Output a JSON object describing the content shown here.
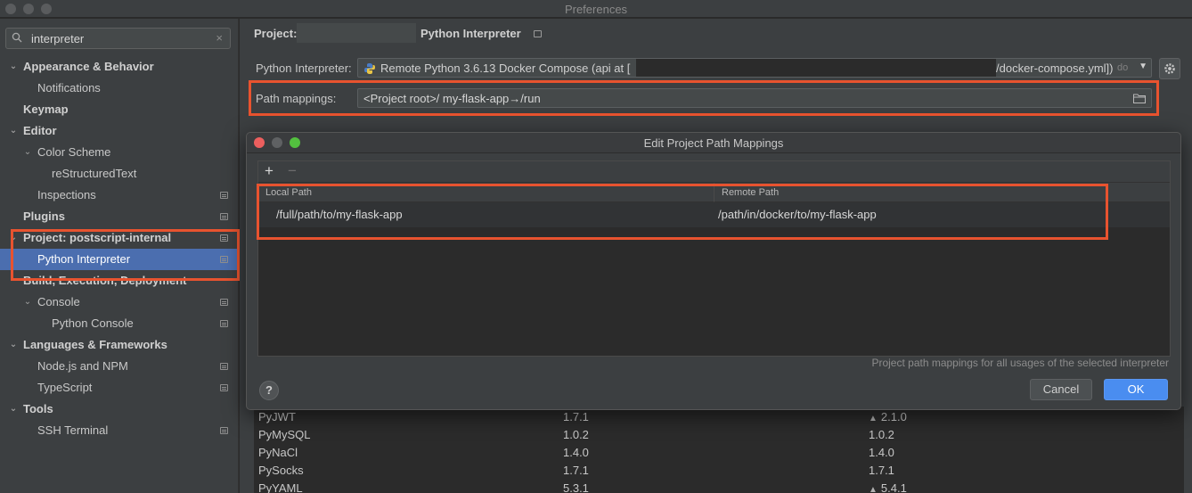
{
  "window": {
    "title": "Preferences"
  },
  "sidebar": {
    "search": {
      "value": "interpreter",
      "clear": "×"
    },
    "items": [
      {
        "label": "Appearance & Behavior",
        "bold": true,
        "arrow": "v"
      },
      {
        "label": "Notifications"
      },
      {
        "label": "Keymap",
        "bold": true
      },
      {
        "label": "Editor",
        "bold": true,
        "arrow": "v"
      },
      {
        "label": "Color Scheme",
        "arrow": "v"
      },
      {
        "label": "reStructuredText"
      },
      {
        "label": "Inspections"
      },
      {
        "label": "Plugins",
        "bold": true
      },
      {
        "label": "Project: postscript-internal",
        "bold": true,
        "arrow": "v"
      },
      {
        "label": "Python Interpreter",
        "selected": true
      },
      {
        "label": "Build, Execution, Deployment",
        "bold": true
      },
      {
        "label": "Console",
        "arrow": "v"
      },
      {
        "label": "Python Console"
      },
      {
        "label": "Languages & Frameworks",
        "bold": true,
        "arrow": "v"
      },
      {
        "label": "Node.js and NPM"
      },
      {
        "label": "TypeScript"
      },
      {
        "label": "Tools",
        "bold": true,
        "arrow": "v"
      },
      {
        "label": "SSH Terminal"
      }
    ]
  },
  "main": {
    "breadcrumb": {
      "project": "Project:",
      "page": "Python Interpreter"
    },
    "interpreter": {
      "label": "Python Interpreter:",
      "value_start": "Remote Python 3.6.13 Docker Compose (api at [",
      "value_end": "/docker-compose.yml])",
      "value_suffix": "do"
    },
    "path_mappings": {
      "label": "Path mappings:",
      "value": "<Project root>/ my-flask-app→/run"
    },
    "packages": [
      {
        "name": "PyJWT",
        "version": "1.7.1",
        "latest": "2.1.0",
        "upgrade": true
      },
      {
        "name": "PyMySQL",
        "version": "1.0.2",
        "latest": "1.0.2",
        "upgrade": false
      },
      {
        "name": "PyNaCl",
        "version": "1.4.0",
        "latest": "1.4.0",
        "upgrade": false
      },
      {
        "name": "PySocks",
        "version": "1.7.1",
        "latest": "1.7.1",
        "upgrade": false
      },
      {
        "name": "PyYAML",
        "version": "5.3.1",
        "latest": "5.4.1",
        "upgrade": true
      }
    ]
  },
  "dialog": {
    "title": "Edit Project Path Mappings",
    "toolbar": {
      "add": "+",
      "remove": "−"
    },
    "columns": {
      "local": "Local Path",
      "remote": "Remote Path"
    },
    "rows": [
      {
        "local": "/full/path/to/my-flask-app",
        "remote": "/path/in/docker/to/my-flask-app"
      }
    ],
    "hint": "Project path mappings for all usages of the selected interpreter",
    "help": "?",
    "cancel": "Cancel",
    "ok": "OK"
  },
  "colors": {
    "accent": "#4a8df0",
    "selection": "#4b6eaf",
    "highlight": "#e8532f"
  }
}
